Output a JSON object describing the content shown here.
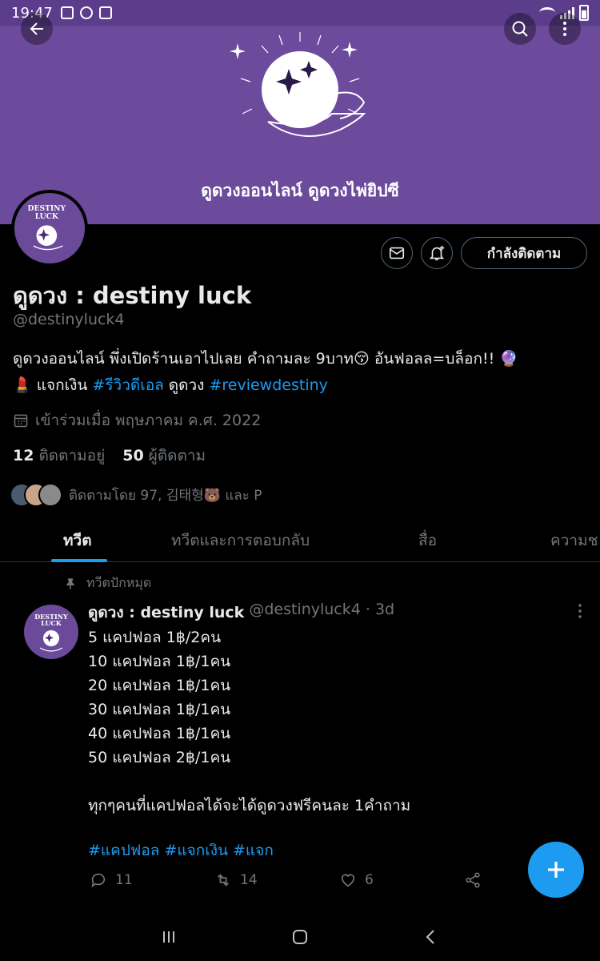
{
  "status_bar": {
    "time": "19:47"
  },
  "banner": {
    "caption": "ดูดวงออนไลน์ ดูดวงไพ่ยิปซี",
    "bg_color": "#6c4a9c"
  },
  "header": {
    "back_icon": "arrow-left-icon",
    "search_icon": "search-icon",
    "more_icon": "more-vertical-icon"
  },
  "profile": {
    "logo_text_line1": "DESTINY",
    "logo_text_line2": "LUCK",
    "display_name": "ดูดวง : destiny luck",
    "handle": "@destinyluck4",
    "bio_text_1": "ดูดวงออนไลน์ พึ่งเปิดร้านเอาไปเลย คำถามละ 9บาท",
    "bio_emoji_1": "😚",
    "bio_text_2": " อันฟอลล=บล็อก!! ",
    "bio_emoji_2": "🔮",
    "bio_emoji_3": "💄",
    "bio_text_3": " แจกเงิน ",
    "bio_hashtag_1": "#รีวิวดีเอล",
    "bio_text_4": " ดูดวง ",
    "bio_hashtag_2": "#reviewdestiny",
    "joined": "เข้าร่วมเมื่อ พฤษภาคม ค.ศ. 2022",
    "following_count": "12",
    "following_label": "ติดตามอยู่",
    "followers_count": "50",
    "followers_label": "ผู้ติดตาม",
    "followed_by": "ติดตามโดย 97, 김태형🐻 และ P",
    "follow_button": "กำลังติดตาม"
  },
  "tabs": [
    {
      "label": "ทวีต"
    },
    {
      "label": "ทวีตและการตอบกลับ"
    },
    {
      "label": "สื่อ"
    },
    {
      "label": "ความช"
    }
  ],
  "tweet": {
    "pinned_label": "ทวีตปักหมุด",
    "name": "ดูดวง : destiny luck",
    "meta": "@destinyluck4 · 3d",
    "lines": [
      "5 แคปฟอล 1฿/2คน",
      "10 แคปฟอล 1฿/1คน",
      "20 แคปฟอล 1฿/1คน",
      "30 แคปฟอล 1฿/1คน",
      "40 แคปฟอล 1฿/1คน",
      "50 แคปฟอล 2฿/1คน",
      "",
      "ทุกๆคนที่แคปฟอลได้จะได้ดูดวงฟรีคนละ 1คำถาม"
    ],
    "hashtags": [
      "#แคปฟอล",
      "#แจกเงิน",
      "#แจก"
    ],
    "replies": "11",
    "retweets": "14",
    "likes": "6"
  },
  "colors": {
    "accent": "#1d9bf0",
    "muted": "#71767b",
    "border": "#2f3336"
  }
}
